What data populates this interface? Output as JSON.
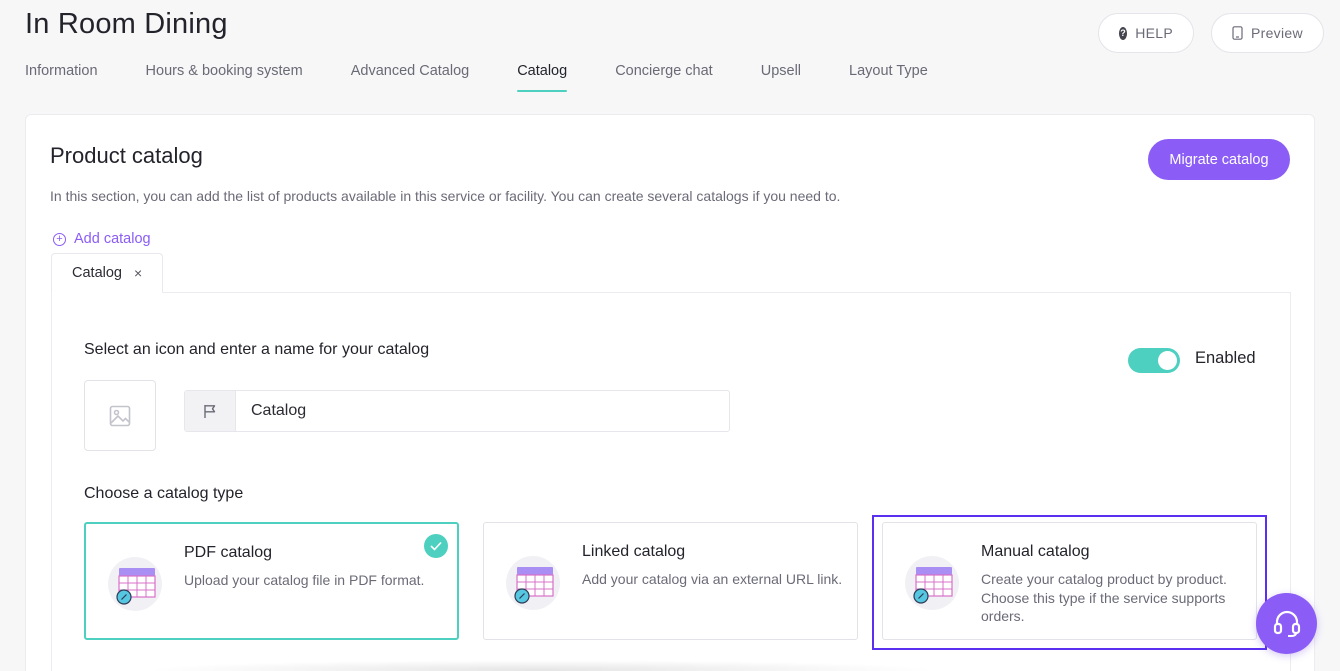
{
  "header": {
    "title": "In Room Dining",
    "help_label": "HELP",
    "preview_label": "Preview"
  },
  "tabs": [
    {
      "label": "Information",
      "active": false
    },
    {
      "label": "Hours & booking system",
      "active": false
    },
    {
      "label": "Advanced Catalog",
      "active": false
    },
    {
      "label": "Catalog",
      "active": true
    },
    {
      "label": "Concierge chat",
      "active": false
    },
    {
      "label": "Upsell",
      "active": false
    },
    {
      "label": "Layout Type",
      "active": false
    }
  ],
  "section": {
    "title": "Product catalog",
    "description": "In this section, you can add the list of products available in this service or facility. You can create several catalogs if you need to.",
    "migrate_label": "Migrate catalog",
    "add_catalog_label": "Add catalog"
  },
  "catalog_tab": {
    "label": "Catalog",
    "close_glyph": "×"
  },
  "form": {
    "icon_name_heading": "Select an icon and enter a name for your catalog",
    "name_value": "Catalog",
    "enabled_label": "Enabled",
    "enabled": true,
    "type_heading": "Choose a catalog type"
  },
  "catalog_types": [
    {
      "title": "PDF catalog",
      "description": "Upload your catalog file in PDF format.",
      "selected": true
    },
    {
      "title": "Linked catalog",
      "description": "Add your catalog via an external URL link.",
      "selected": false
    },
    {
      "title": "Manual catalog",
      "description": "Create your catalog product by product. Choose this type if the service supports orders.",
      "selected": false
    }
  ],
  "colors": {
    "accent_purple": "#8b5cf6",
    "accent_teal": "#4dd0c0",
    "highlight_border": "#5b2ff0"
  },
  "icons": {
    "help": "question-circle-icon",
    "preview": "phone-icon",
    "add": "plus-circle-icon",
    "image_placeholder": "image-icon",
    "flag": "flag-icon",
    "catalog_type": "table-link-icon",
    "check": "check-icon",
    "support": "headset-icon"
  }
}
